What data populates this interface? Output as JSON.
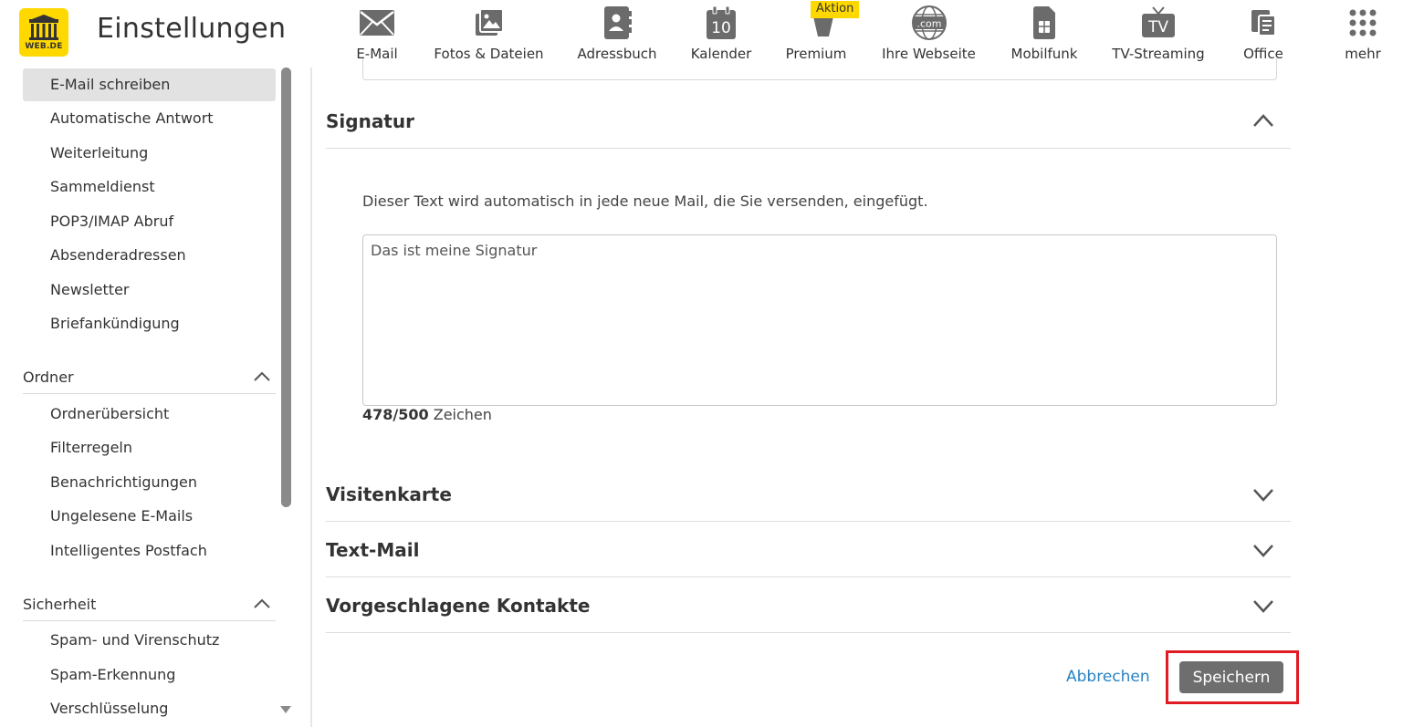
{
  "header": {
    "logo_text": "WEB.DE",
    "title": "Einstellungen",
    "badge": "Aktion",
    "nav": [
      {
        "label": "E-Mail",
        "icon": "envelope-icon"
      },
      {
        "label": "Fotos & Dateien",
        "icon": "photos-icon"
      },
      {
        "label": "Adressbuch",
        "icon": "address-book-icon"
      },
      {
        "label": "Kalender",
        "icon": "calendar-icon",
        "day": "10"
      },
      {
        "label": "Premium",
        "icon": "basket-icon"
      },
      {
        "label": "Ihre Webseite",
        "icon": "globe-com-icon",
        "sub": ".com"
      },
      {
        "label": "Mobilfunk",
        "icon": "sim-card-icon"
      },
      {
        "label": "TV-Streaming",
        "icon": "tv-icon",
        "sub": "TV"
      },
      {
        "label": "Office",
        "icon": "office-documents-icon"
      },
      {
        "label": "mehr",
        "icon": "grid-dots-icon"
      }
    ]
  },
  "sidebar": {
    "email_items": [
      "E-Mail schreiben",
      "Automatische Antwort",
      "Weiterleitung",
      "Sammeldienst",
      "POP3/IMAP Abruf",
      "Absenderadressen",
      "Newsletter",
      "Briefankündigung"
    ],
    "sections": [
      {
        "title": "Ordner",
        "items": [
          "Ordnerübersicht",
          "Filterregeln",
          "Benachrichtigungen",
          "Ungelesene E-Mails",
          "Intelligentes Postfach"
        ]
      },
      {
        "title": "Sicherheit",
        "items": [
          "Spam- und Virenschutz",
          "Spam-Erkennung",
          "Verschlüsselung"
        ]
      }
    ]
  },
  "main": {
    "signature": {
      "title": "Signatur",
      "description": "Dieser Text wird automatisch in jede neue Mail, die Sie versenden, eingefügt.",
      "value": "Das ist meine Signatur",
      "count": "478/500",
      "count_unit": "Zeichen"
    },
    "sections": [
      "Visitenkarte",
      "Text-Mail",
      "Vorgeschlagene Kontakte"
    ],
    "cancel_label": "Abbrechen",
    "save_label": "Speichern"
  },
  "colors": {
    "brand_yellow": "#ffd800",
    "link_blue": "#2a83c4",
    "save_button": "#6e6e6e",
    "highlight_red": "#e01b24",
    "active_item_bg": "#e2e2e2"
  }
}
